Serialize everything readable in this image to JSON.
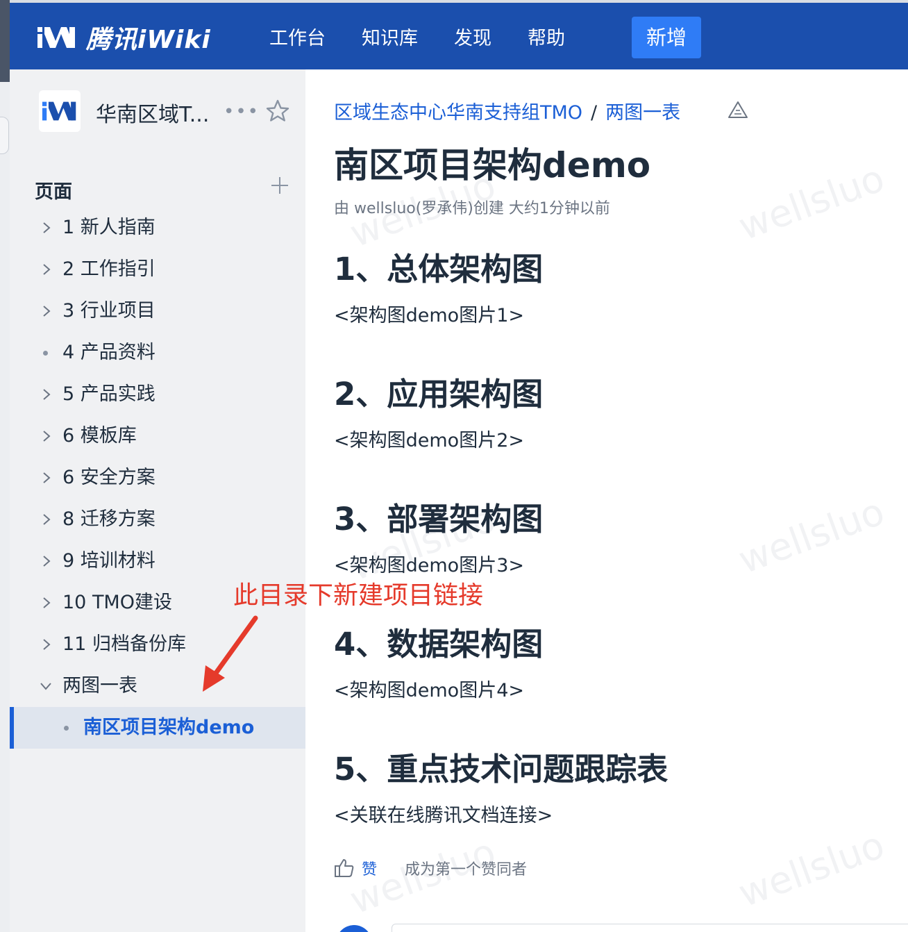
{
  "header": {
    "logo_text": "腾讯iWiki",
    "nav": [
      "工作台",
      "知识库",
      "发现",
      "帮助"
    ],
    "new_button": "新增"
  },
  "sidebar": {
    "space_name": "华南区域T...",
    "more": "•••",
    "pages_title": "页面",
    "tree": [
      {
        "label": "1 新人指南",
        "type": "collapsed"
      },
      {
        "label": "2 工作指引",
        "type": "collapsed"
      },
      {
        "label": "3 行业项目",
        "type": "collapsed"
      },
      {
        "label": "4 产品资料",
        "type": "leaf"
      },
      {
        "label": "5 产品实践",
        "type": "collapsed"
      },
      {
        "label": "6 模板库",
        "type": "collapsed"
      },
      {
        "label": "6 安全方案",
        "type": "collapsed"
      },
      {
        "label": "8 迁移方案",
        "type": "collapsed"
      },
      {
        "label": "9 培训材料",
        "type": "collapsed"
      },
      {
        "label": "10 TMO建设",
        "type": "collapsed"
      },
      {
        "label": "11 归档备份库",
        "type": "collapsed"
      },
      {
        "label": "两图一表",
        "type": "expanded"
      },
      {
        "label": "南区项目架构demo",
        "type": "active-child"
      }
    ]
  },
  "content": {
    "breadcrumb": [
      "区域生态中心华南支持组TMO",
      "两图一表"
    ],
    "breadcrumb_sep": "/",
    "title": "南区项目架构demo",
    "meta": "由 wellsluo(罗承伟)创建 大约1分钟以前",
    "sections": [
      {
        "heading": "1、总体架构图",
        "body": "<架构图demo图片1>"
      },
      {
        "heading": "2、应用架构图",
        "body": "<架构图demo图片2>"
      },
      {
        "heading": "3、部署架构图",
        "body": "<架构图demo图片3>"
      },
      {
        "heading": "4、数据架构图",
        "body": "<架构图demo图片4>"
      },
      {
        "heading": "5、重点技术问题跟踪表",
        "body": "<关联在线腾讯文档连接>"
      }
    ],
    "like_label": "赞",
    "like_desc": "成为第一个赞同者"
  },
  "annotation": "此目录下新建项目链接",
  "watermark": "wellsluo",
  "colors": {
    "header_bg": "#1b4fad",
    "new_button": "#2f7cf6",
    "link": "#1b5fd6",
    "annotation": "#e53a2b"
  }
}
